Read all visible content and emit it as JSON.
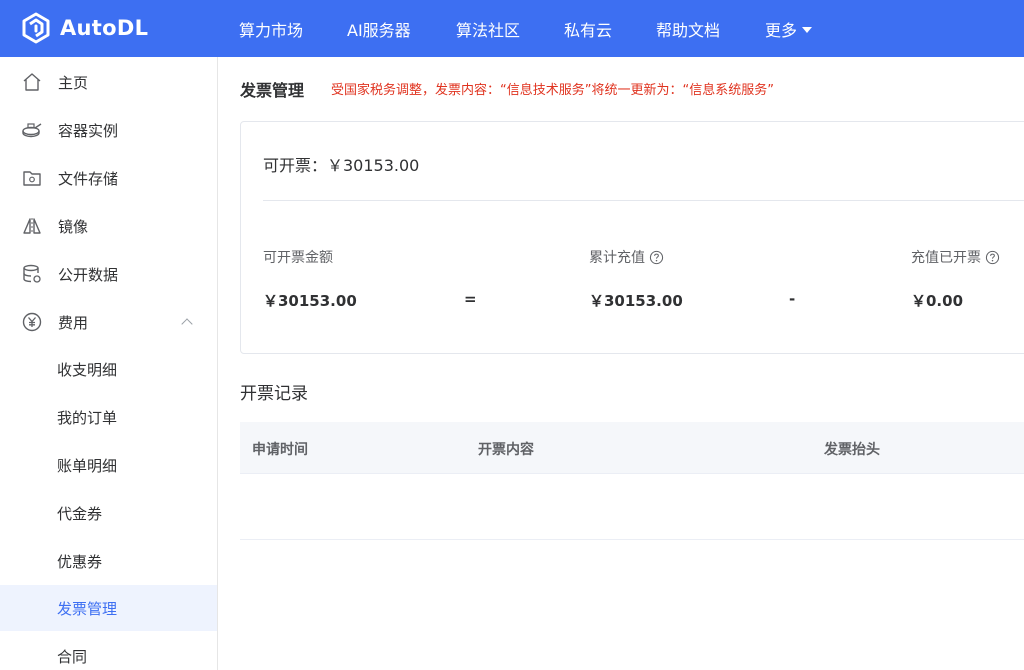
{
  "brand": {
    "name": "AutoDL",
    "color": "#3d6ff2"
  },
  "nav": {
    "items": [
      "算力市场",
      "AI服务器",
      "算法社区",
      "私有云",
      "帮助文档"
    ],
    "more": "更多"
  },
  "sidebar": {
    "items": [
      {
        "label": "主页",
        "icon": "home-icon"
      },
      {
        "label": "容器实例",
        "icon": "container-icon"
      },
      {
        "label": "文件存储",
        "icon": "storage-icon"
      },
      {
        "label": "镜像",
        "icon": "mirror-icon"
      },
      {
        "label": "公开数据",
        "icon": "database-icon"
      },
      {
        "label": "费用",
        "icon": "yen-icon",
        "expanded": true
      }
    ],
    "sub_items": [
      {
        "label": "收支明细"
      },
      {
        "label": "我的订单"
      },
      {
        "label": "账单明细"
      },
      {
        "label": "代金券"
      },
      {
        "label": "优惠券"
      },
      {
        "label": "发票管理",
        "active": true
      },
      {
        "label": "合同"
      }
    ]
  },
  "main": {
    "title": "发票管理",
    "notice": "受国家税务调整，发票内容：“信息技术服务”将统一更新为：“信息系统服务”",
    "invoiceable_line": "可开票：￥30153.00",
    "stats": {
      "label1": "可开票金额",
      "value1": "￥30153.00",
      "equals": "=",
      "label2": "累计充值",
      "value2": "￥30153.00",
      "minus": "-",
      "label3": "充值已开票",
      "value3": "￥0.00"
    },
    "records_title": "开票记录",
    "table": {
      "columns": [
        "申请时间",
        "开票内容",
        "发票抬头"
      ]
    }
  }
}
